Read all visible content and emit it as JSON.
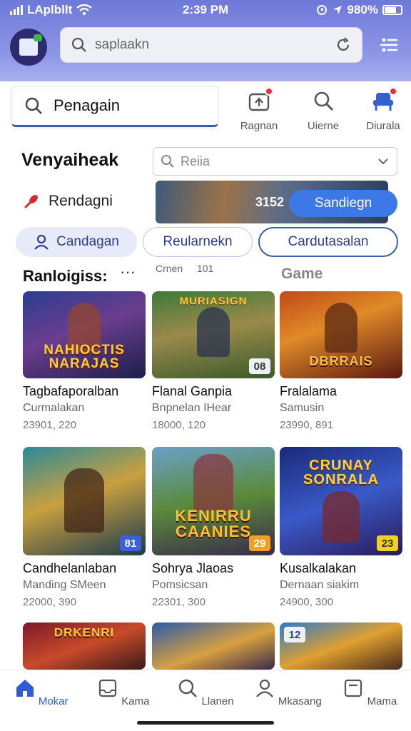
{
  "status_bar": {
    "carrier": "LAplbllt",
    "time": "2:39 PM",
    "battery": "980%"
  },
  "top_search": {
    "text": "saplaakn"
  },
  "search": {
    "text": "Penagain"
  },
  "quick_icons": [
    {
      "label": "Ragnan",
      "icon": "gift-icon"
    },
    {
      "label": "Uierne",
      "icon": "search-icon"
    },
    {
      "label": "Diurala",
      "icon": "chair-icon"
    }
  ],
  "filter": {
    "title": "Venyaiheak",
    "select_placeholder": "Reiia",
    "tag_label": "Rendagni",
    "banner_count": "3152",
    "banner_button": "Sandiegn"
  },
  "chips": [
    "Candagan",
    "Reularnekn",
    "Cardutasalan"
  ],
  "list": {
    "header": "Ranloigiss:",
    "more": "···",
    "sub_a": "Crnen",
    "sub_b": "101",
    "category": "Game"
  },
  "games": [
    {
      "name": "Tagbafaporalban",
      "developer": "Curmalakan",
      "stats": "23901, 220",
      "art": "NAHIOCTIS\nNARAJAS",
      "badge": ""
    },
    {
      "name": "Flanal Ganpia",
      "developer": "Bnpnelan IHear",
      "stats": "18000, 120",
      "art": "MURIASIGN",
      "badge": "08"
    },
    {
      "name": "Fralalama",
      "developer": "Samusin",
      "stats": "23990, 891",
      "art": "DBRRAIS",
      "badge": ""
    },
    {
      "name": "Candhelanlaban",
      "developer": "Manding SMeen",
      "stats": "22000, 390",
      "art": "",
      "badge": "81"
    },
    {
      "name": "Sohrya Jlaoas",
      "developer": "Pomsicsan",
      "stats": "22301, 300",
      "art": "KENIRRU\nCAANIES",
      "badge": "29"
    },
    {
      "name": "Kusalkalakan",
      "developer": "Dernaan siakim",
      "stats": "24900, 300",
      "art": "CRUNAY\nSONRALA",
      "badge": "23"
    },
    {
      "name": "",
      "developer": "",
      "stats": "",
      "art": "DRKENRI",
      "badge": ""
    },
    {
      "name": "",
      "developer": "",
      "stats": "",
      "art": "",
      "badge": ""
    },
    {
      "name": "",
      "developer": "",
      "stats": "",
      "art": "",
      "badge": "12"
    }
  ],
  "bottom_nav": [
    {
      "label": "Mokar",
      "icon": "home-icon",
      "active": true
    },
    {
      "label": "Kama",
      "icon": "inbox-icon",
      "active": false
    },
    {
      "label": "Llanen",
      "icon": "search-icon",
      "active": false
    },
    {
      "label": "Mkasang",
      "icon": "profile-icon",
      "active": false
    },
    {
      "label": "Mama",
      "icon": "window-icon",
      "active": false
    }
  ],
  "colors": {
    "accent": "#3d79e6",
    "header": "#7c86de",
    "active_nav": "#2f5bd6"
  }
}
